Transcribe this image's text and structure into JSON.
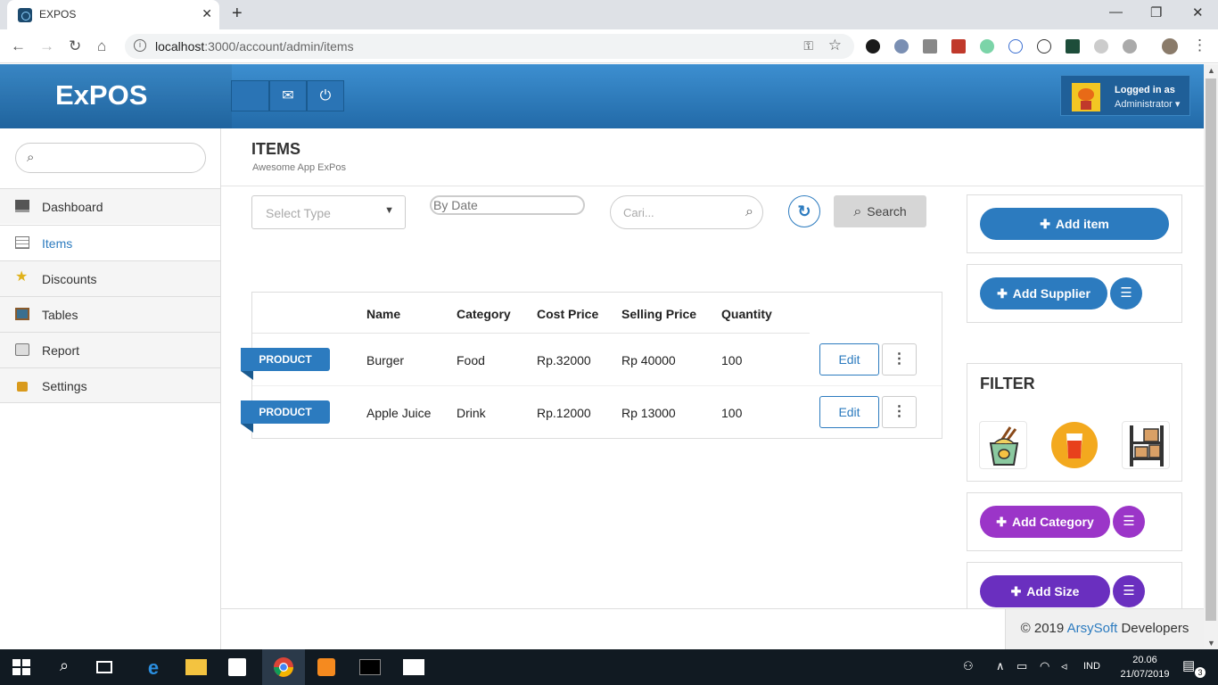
{
  "browser": {
    "tab_title": "EXPOS",
    "url_host": "localhost",
    "url_rest": ":3000/account/admin/items",
    "new_tab": "+",
    "tab_close": "✕"
  },
  "header": {
    "brand": "ExPOS",
    "user_label": "Logged in as",
    "user_role": "Administrator ▾"
  },
  "sidebar": {
    "search_placeholder": "",
    "items": [
      {
        "label": "Dashboard",
        "icon": "monitor-icon"
      },
      {
        "label": "Items",
        "icon": "list-icon",
        "active": true
      },
      {
        "label": "Discounts",
        "icon": "star-icon"
      },
      {
        "label": "Tables",
        "icon": "table-icon"
      },
      {
        "label": "Report",
        "icon": "printer-icon"
      },
      {
        "label": "Settings",
        "icon": "lock-icon"
      }
    ]
  },
  "page": {
    "title": "ITEMS",
    "subtitle": "Awesome App ExPos"
  },
  "filters": {
    "select_type_placeholder": "Select Type",
    "by_date_placeholder": "By Date",
    "cari_placeholder": "Cari...",
    "search_label": "Search"
  },
  "table": {
    "headers": [
      "Name",
      "Category",
      "Cost Price",
      "Selling Price",
      "Quantity"
    ],
    "rows": [
      {
        "badge": "PRODUCT",
        "name": "Burger",
        "category": "Food",
        "cost": "Rp.32000",
        "selling": "Rp 40000",
        "quantity": "100",
        "edit": "Edit"
      },
      {
        "badge": "PRODUCT",
        "name": "Apple Juice",
        "category": "Drink",
        "cost": "Rp.12000",
        "selling": "Rp 13000",
        "quantity": "100",
        "edit": "Edit"
      }
    ]
  },
  "panel": {
    "add_item": "Add item",
    "add_supplier": "Add Supplier",
    "filter_title": "FILTER",
    "add_category": "Add Category",
    "add_size": "Add Size"
  },
  "footer": {
    "copyright": "© 2019",
    "company": "ArsySoft",
    "suffix": "Developers"
  },
  "taskbar": {
    "time": "20.06",
    "date": "21/07/2019",
    "lang": "IND",
    "notif_count": "3"
  },
  "colors": {
    "primary": "#2c7bbf",
    "category_purple": "#9b35c8",
    "size_violet": "#6a2fbf"
  }
}
